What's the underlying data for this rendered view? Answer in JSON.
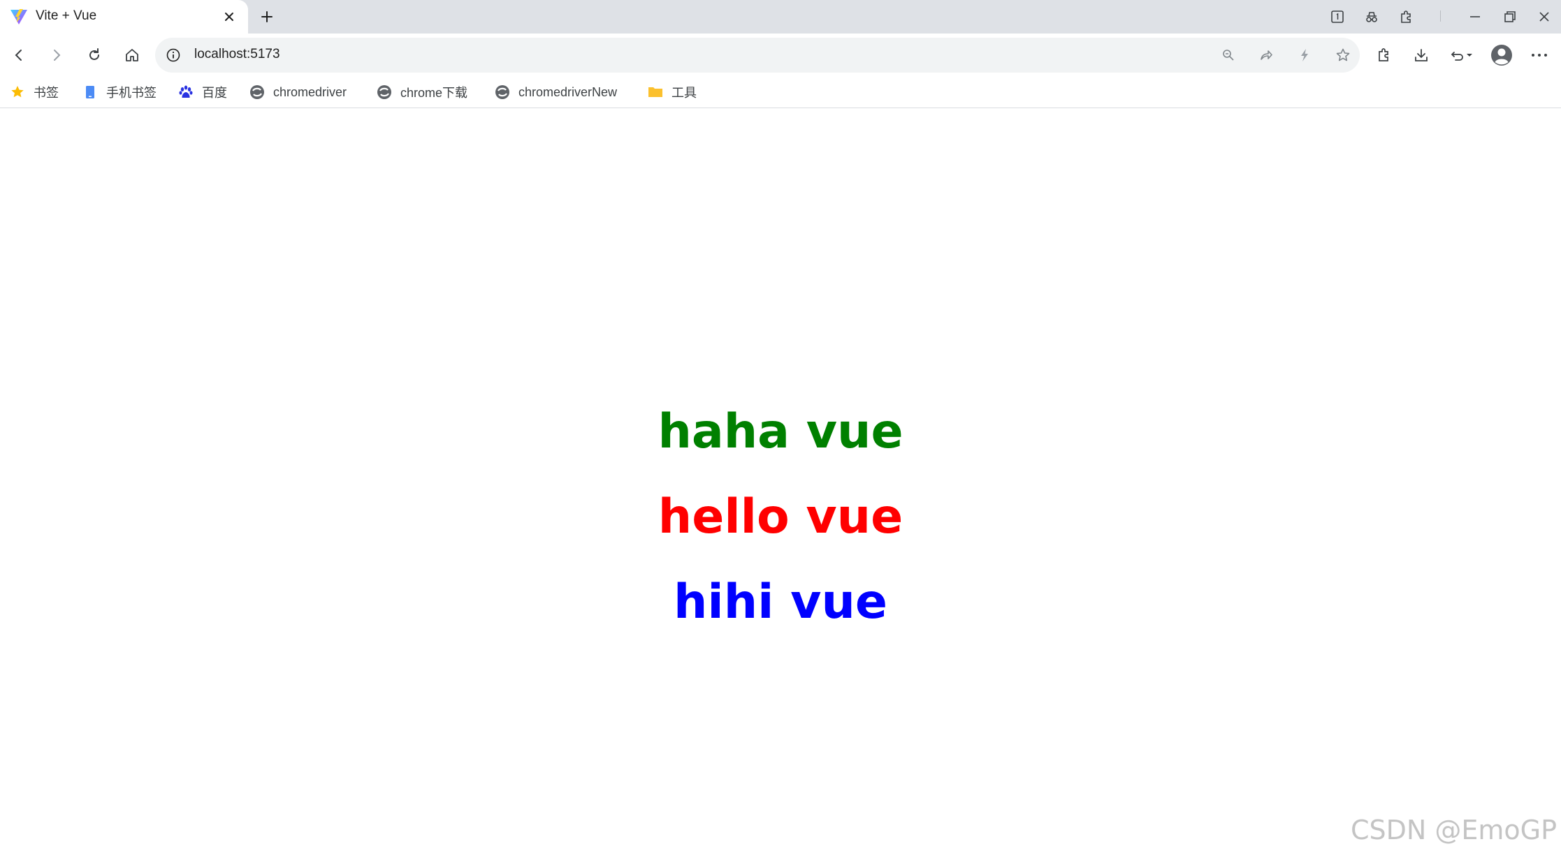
{
  "browser": {
    "tab": {
      "title": "Vite + Vue",
      "favicon": "vite-logo-icon"
    },
    "address_bar": {
      "url": "localhost:5173"
    },
    "bookmarks": [
      {
        "label": "书签",
        "icon": "star-icon"
      },
      {
        "label": "手机书签",
        "icon": "mobile-icon"
      },
      {
        "label": "百度",
        "icon": "baidu-paw-icon"
      },
      {
        "label": "chromedriver",
        "icon": "site-globe-icon"
      },
      {
        "label": "chrome下载",
        "icon": "site-globe-icon"
      },
      {
        "label": "chromedriverNew",
        "icon": "site-globe-icon"
      },
      {
        "label": "工具",
        "icon": "folder-icon"
      }
    ]
  },
  "page": {
    "messages": [
      {
        "text": "haha vue",
        "color": "#008000"
      },
      {
        "text": "hello vue",
        "color": "#ff0000"
      },
      {
        "text": "hihi vue",
        "color": "#0000ff"
      }
    ],
    "watermark": "CSDN @EmoGP"
  }
}
